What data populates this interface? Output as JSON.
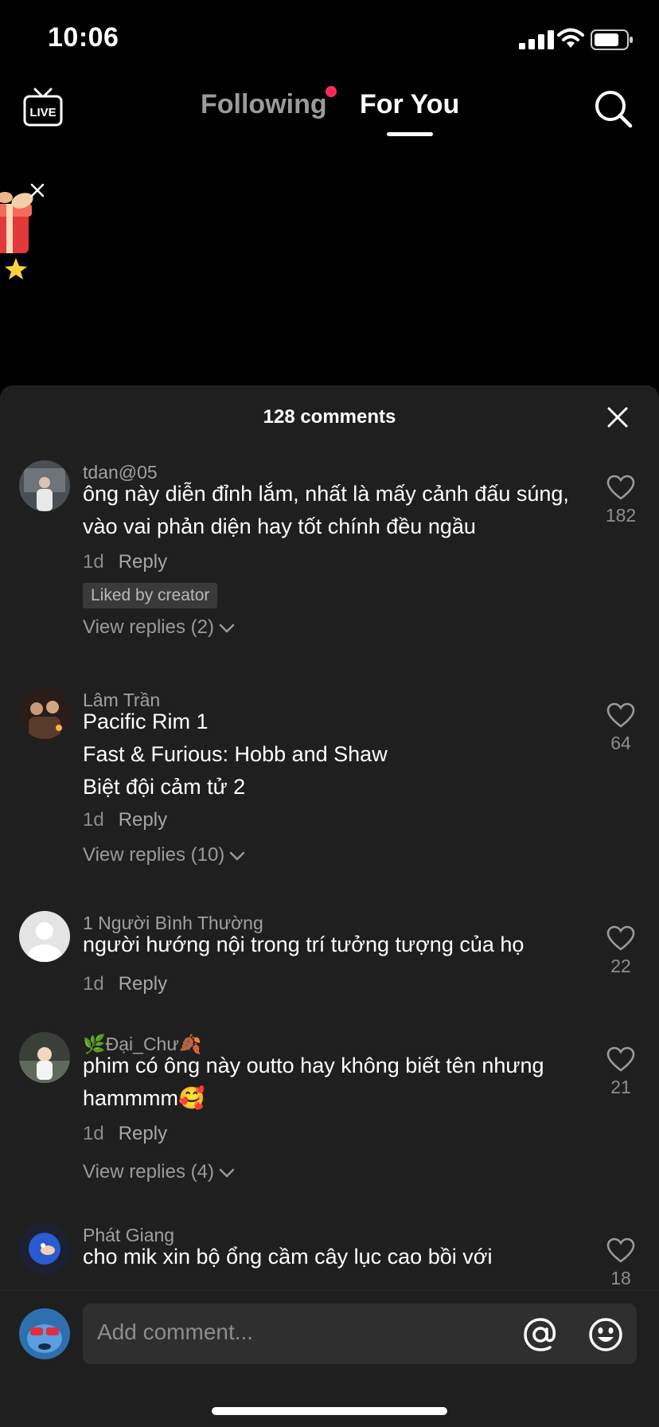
{
  "status_bar": {
    "time": "10:06"
  },
  "nav": {
    "live_label": "LIVE",
    "tabs": [
      {
        "label": "Following"
      },
      {
        "label": "For You"
      }
    ]
  },
  "sheet": {
    "title": "128 comments",
    "comments": [
      {
        "user": "tdan@05",
        "text": "ông này diễn đỉnh lắm, nhất là mấy cảnh đấu súng, vào vai phản diện hay tốt chính đều ngầu",
        "time": "1d",
        "reply": "Reply",
        "badge": "Liked by creator",
        "view_replies": "View replies (2)",
        "likes": "182"
      },
      {
        "user": "Lâm Trần",
        "lines": [
          "Pacific Rim 1",
          "Fast & Furious: Hobb and Shaw",
          "Biệt đội cảm tử 2"
        ],
        "time": "1d",
        "reply": "Reply",
        "view_replies": "View replies (10)",
        "likes": "64"
      },
      {
        "user": "1 Người Bình Thường",
        "text": "người hướng nội trong trí tưởng tượng của họ",
        "time": "1d",
        "reply": "Reply",
        "likes": "22"
      },
      {
        "user": "🌿Đại_Chư🍂",
        "text": "phim có ông này outto hay không biết tên nhưng hammmm🥰",
        "time": "1d",
        "reply": "Reply",
        "view_replies": "View replies (4)",
        "likes": "21"
      },
      {
        "user": "Phát Giang",
        "text": "cho mik xin bộ ổng cầm cây lục cao bồi với",
        "likes": "18"
      }
    ]
  },
  "comment_bar": {
    "placeholder": "Add comment..."
  },
  "colors": {
    "accent": "#fe2c55",
    "sheet_bg": "#1f1f1f",
    "input_bg": "#2f2f2f"
  }
}
